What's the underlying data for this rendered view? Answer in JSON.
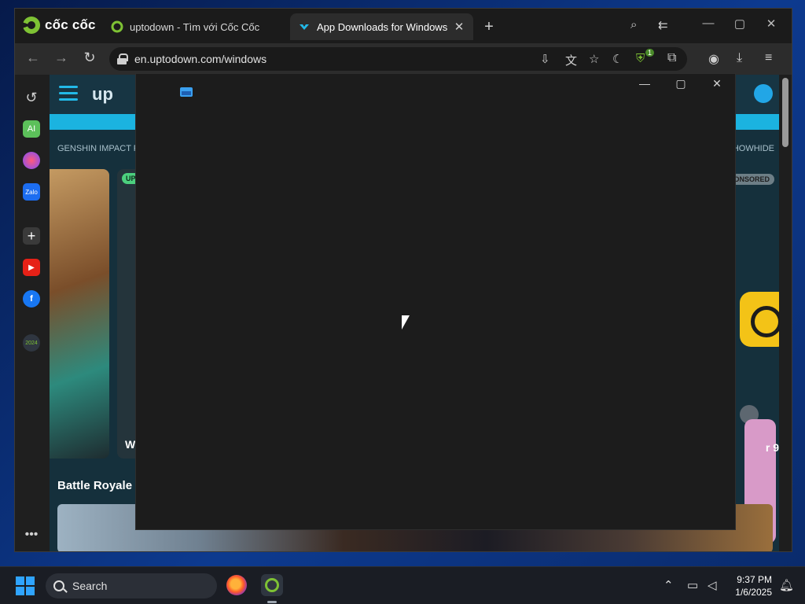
{
  "browser": {
    "brand": "cốc cốc",
    "tabs": [
      {
        "title": "uptodown - Tìm với Cốc Cốc"
      },
      {
        "title": "App Downloads for Windows"
      }
    ],
    "new_tab_symbol": "+",
    "url": "en.uptodown.com/windows",
    "extension_badge": "1"
  },
  "page": {
    "brand_text": "up",
    "category_left": "GENSHIN IMPACT    FO",
    "category_right": "HOWHIDE",
    "left_pill": "UP",
    "left_card_text": "W",
    "sponsored_pill": "ONSORED",
    "right_card_text": "r 9",
    "section_title": "Battle Royale"
  },
  "rail": {
    "ai_label": "AI",
    "zalo_label": "Zalo",
    "badge_2024": "2024"
  },
  "taskbar": {
    "search_label": "Search",
    "time": "9:37 PM",
    "date": "1/6/2025"
  },
  "colors": {
    "accent_blue": "#1bb3e0",
    "coccoc_green": "#7ec234",
    "window_dark": "#1c1c1c"
  }
}
